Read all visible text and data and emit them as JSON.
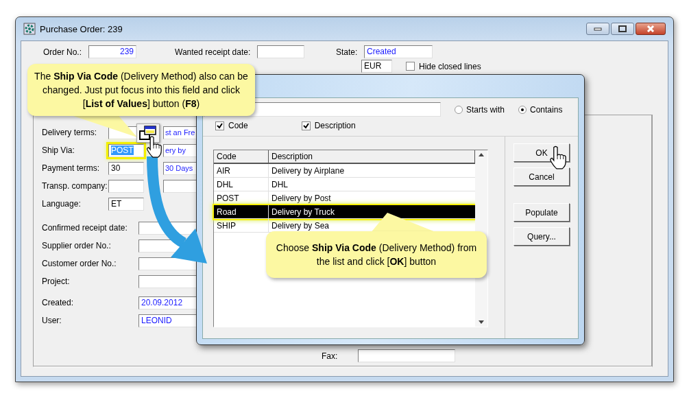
{
  "window": {
    "title": "Purchase Order: 239"
  },
  "header": {
    "order_no": {
      "label": "Order No.:",
      "value": "239"
    },
    "wanted_receipt_date": {
      "label": "Wanted receipt date:"
    },
    "state": {
      "label": "State:",
      "value": "Created"
    },
    "currency": {
      "value": "EUR"
    },
    "hide_closed_lines": {
      "label": "Hide closed lines",
      "checked": false
    }
  },
  "delivery_fields": [
    {
      "label": "Delivery terms:",
      "kind": "pair",
      "description": "st an Fre",
      "selected": false
    },
    {
      "label": "Ship Via:",
      "kind": "pair",
      "code": "POST",
      "description": "ery by",
      "selected": true
    },
    {
      "label": "Payment terms:",
      "kind": "pair",
      "code": "30",
      "description": "30 Days",
      "selected": false
    },
    {
      "label": "Transp. company:",
      "kind": "pair",
      "selected": false
    },
    {
      "label": "Language:",
      "kind": "single",
      "code": "ET",
      "selected": false
    }
  ],
  "receipt_fields": [
    {
      "label": "Confirmed receipt date:"
    },
    {
      "label": "Supplier order No.:"
    },
    {
      "label": "Customer order No.:"
    },
    {
      "label": "Project:"
    }
  ],
  "audit_fields": [
    {
      "label": "Created:",
      "value": "20.09.2012"
    },
    {
      "label": "User:",
      "value": "LEONID"
    }
  ],
  "fax": {
    "label": "Fax:"
  },
  "dialog": {
    "match_mode": [
      {
        "label": "Starts with",
        "selected": false
      },
      {
        "label": "Contains",
        "selected": true
      }
    ],
    "search_in": [
      {
        "label": "Code",
        "checked": true
      },
      {
        "label": "Description",
        "checked": true
      }
    ],
    "list": {
      "columns": [
        "Code",
        "Description"
      ],
      "rows": [
        {
          "code": "AIR",
          "description": "Delivery by Airplane",
          "selected": false
        },
        {
          "code": "DHL",
          "description": "DHL",
          "selected": false
        },
        {
          "code": "POST",
          "description": "Delivery by Post",
          "selected": false
        },
        {
          "code": "Road",
          "description": "Delivery by Truck",
          "selected": true
        },
        {
          "code": "SHIP",
          "description": "Delivery by Sea",
          "selected": false
        }
      ]
    },
    "buttons": [
      "OK",
      "Cancel"
    ],
    "query_buttons": [
      "Populate",
      "Query..."
    ]
  },
  "callouts": [
    {
      "text": "The **Ship Via Code** (Delivery Method) also can be changed.  Just put focus into this field and click [**List of Values**] button (**F8**)"
    },
    {
      "text": "Choose **Ship Via Code** (Delivery Method) from the list and click [**OK**] button"
    }
  ]
}
